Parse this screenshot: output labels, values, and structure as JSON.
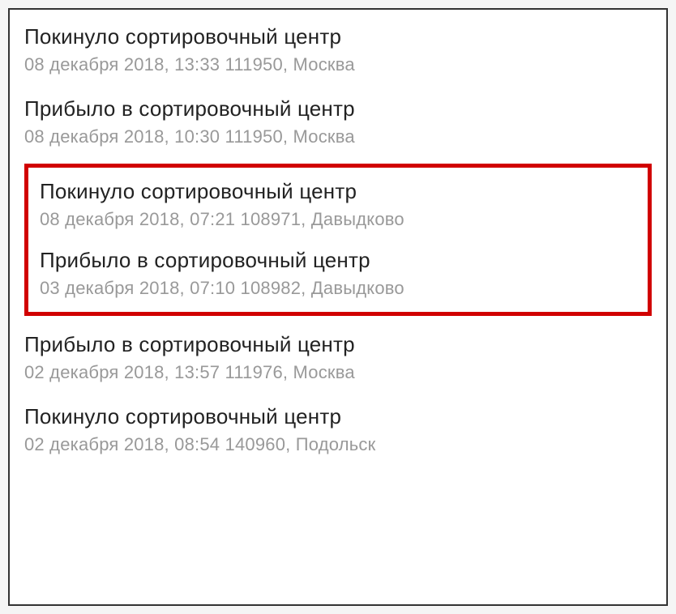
{
  "tracking": {
    "events": [
      {
        "title": "Покинуло сортировочный центр",
        "details": "08 декабря 2018, 13:33 111950, Москва"
      },
      {
        "title": "Прибыло в сортировочный центр",
        "details": "08 декабря 2018, 10:30 111950, Москва"
      }
    ],
    "highlighted": [
      {
        "title": "Покинуло сортировочный центр",
        "details": "08 декабря 2018, 07:21 108971, Давыдково"
      },
      {
        "title": "Прибыло в сортировочный центр",
        "details": "03 декабря 2018, 07:10 108982, Давыдково"
      }
    ],
    "events_after": [
      {
        "title": "Прибыло в сортировочный центр",
        "details": "02 декабря 2018, 13:57 111976, Москва"
      },
      {
        "title": "Покинуло сортировочный центр",
        "details": "02 декабря 2018, 08:54 140960, Подольск"
      }
    ]
  }
}
